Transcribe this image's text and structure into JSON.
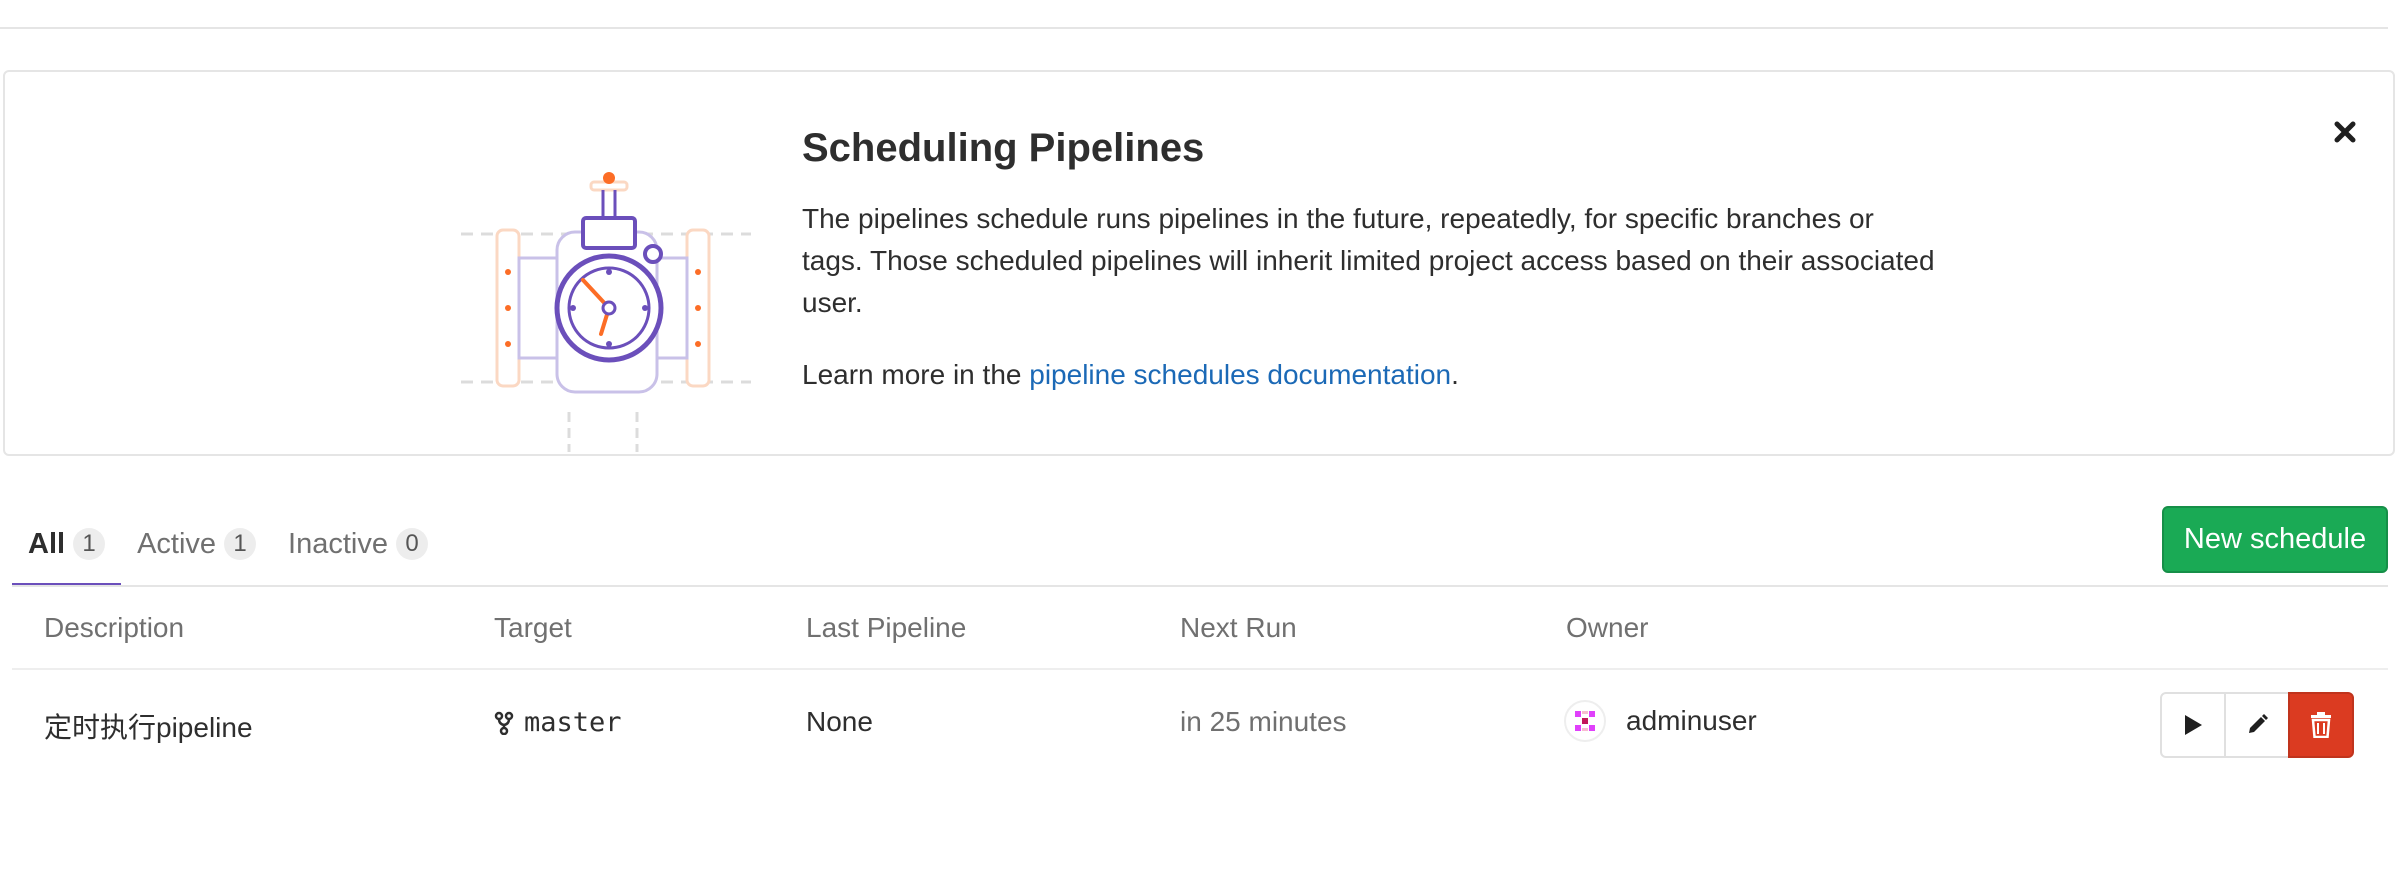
{
  "banner": {
    "title": "Scheduling Pipelines",
    "body": "The pipelines schedule runs pipelines in the future, repeatedly, for specific branches or tags. Those scheduled pipelines will inherit limited project access based on their associated user.",
    "learn_prefix": "Learn more in the ",
    "learn_link": "pipeline schedules documentation",
    "learn_suffix": ".",
    "close_icon": "close-icon"
  },
  "tabs": [
    {
      "label": "All",
      "count": "1",
      "active": true
    },
    {
      "label": "Active",
      "count": "1",
      "active": false
    },
    {
      "label": "Inactive",
      "count": "0",
      "active": false
    }
  ],
  "new_schedule_label": "New schedule",
  "table": {
    "headers": [
      "Description",
      "Target",
      "Last Pipeline",
      "Next Run",
      "Owner"
    ],
    "rows": [
      {
        "description": "定时执行pipeline",
        "target": "master",
        "last_pipeline": "None",
        "next_run": "in 25 minutes",
        "owner": "adminuser"
      }
    ]
  },
  "colors": {
    "accent": "#6b4fbb",
    "success": "#1aaa55",
    "danger": "#db3b21",
    "link": "#1b69b6"
  },
  "icons": [
    "pipeline-schedule-illustration",
    "close-icon",
    "branch-icon",
    "avatar-identicon",
    "play-icon",
    "pencil-icon",
    "trash-icon"
  ]
}
